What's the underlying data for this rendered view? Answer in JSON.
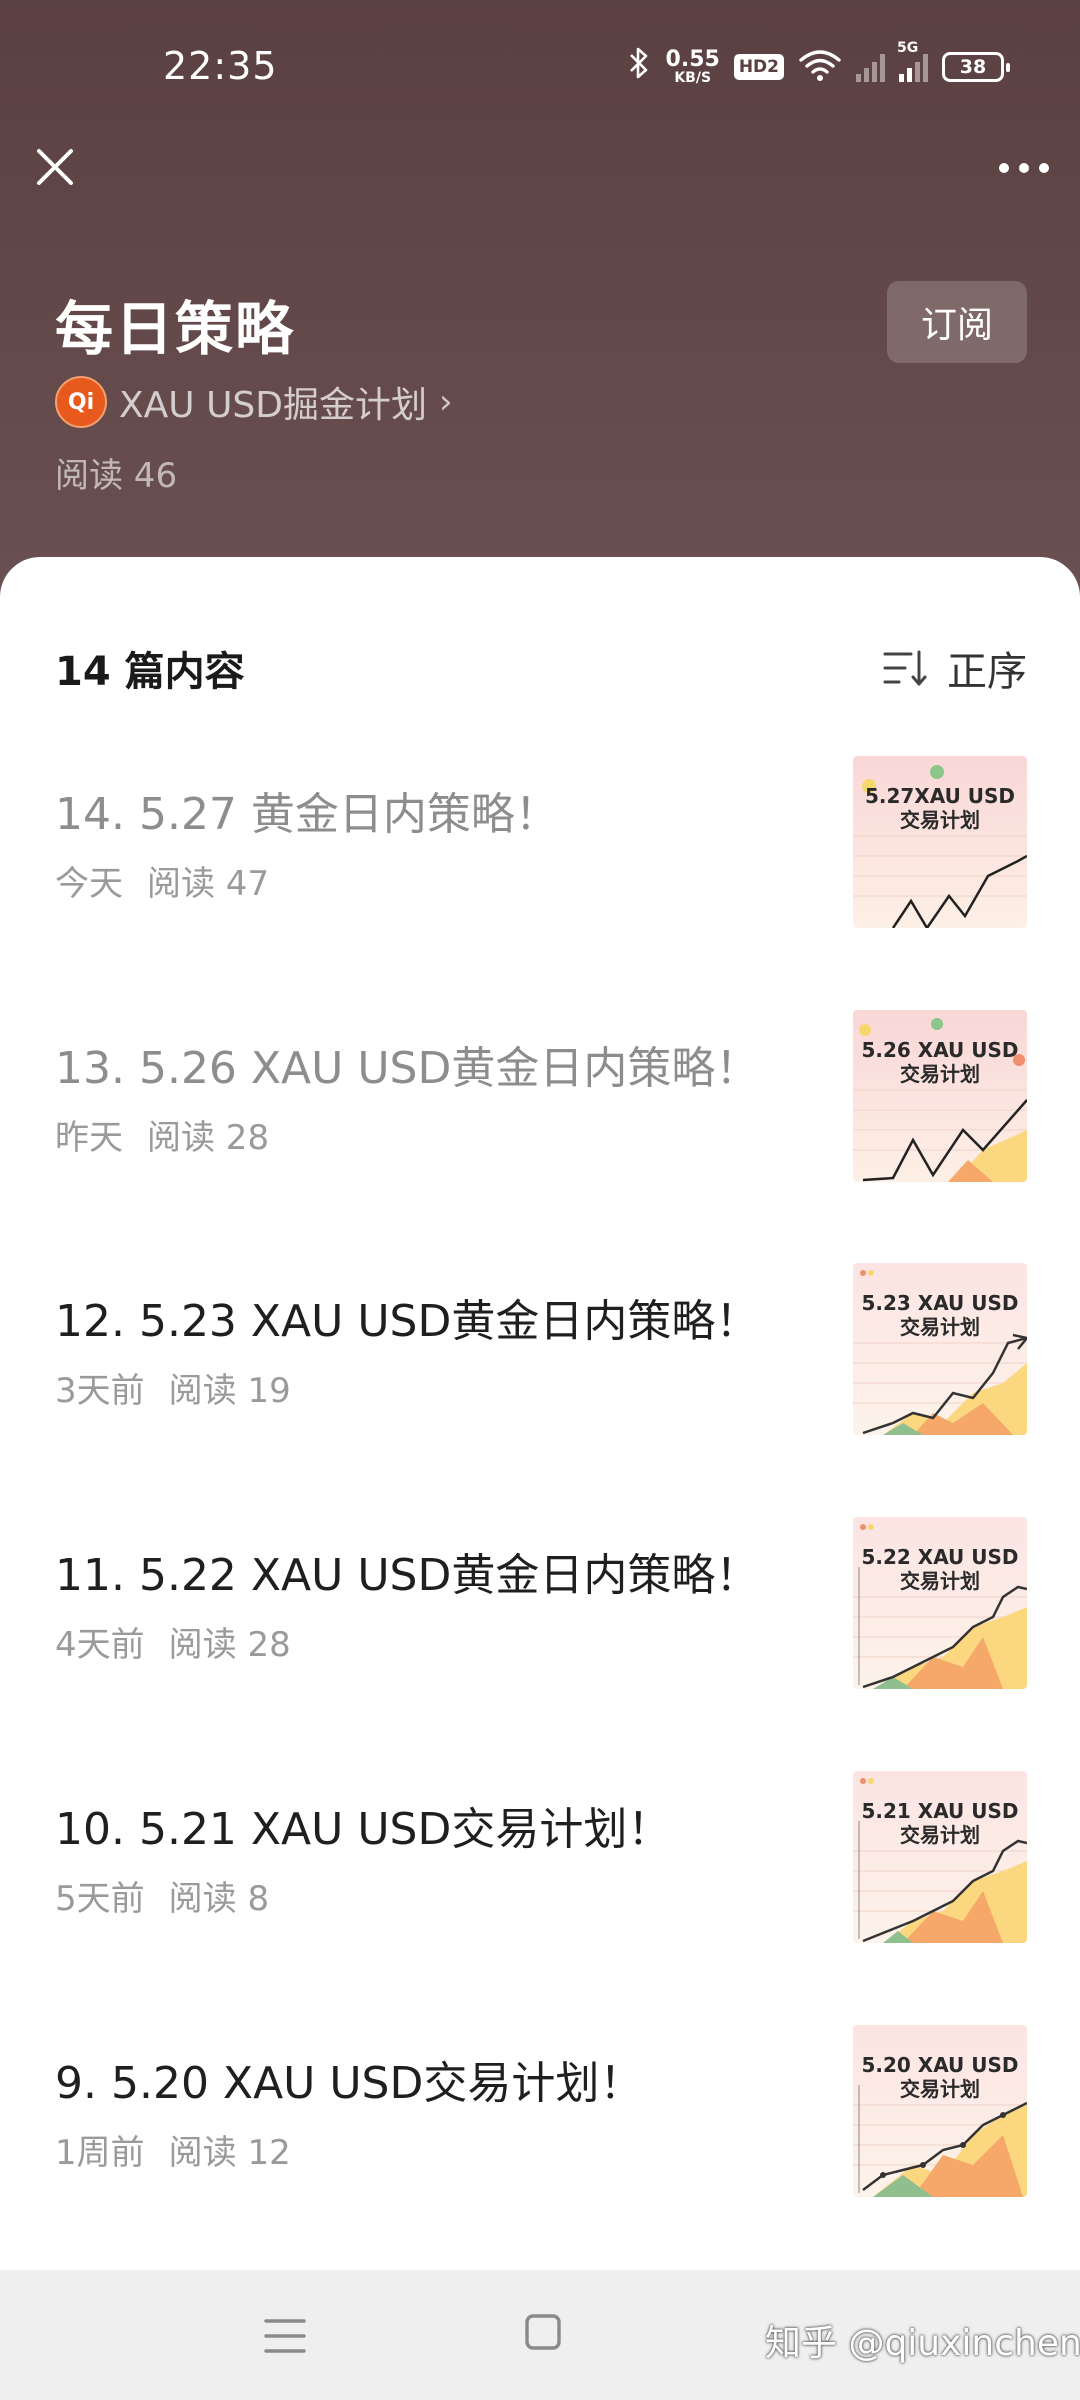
{
  "status_bar": {
    "time": "22:35",
    "net_speed_value": "0.55",
    "net_speed_unit": "KB/S",
    "hd_label": "HD2",
    "signal_tag": "5G",
    "battery_level": "38",
    "icons": [
      "bluetooth-icon",
      "wifi-icon",
      "signal-icon",
      "battery-icon"
    ]
  },
  "header": {
    "title": "每日策略",
    "subscribe_label": "订阅",
    "author": {
      "avatar_text": "Qi",
      "name": "XAU USD掘金计划"
    },
    "read_count": "阅读 46"
  },
  "list": {
    "count_label": "14 篇内容",
    "sort_label": "正序",
    "articles": [
      {
        "title": "14. 5.27 黄金日内策略！",
        "time": "今天",
        "reads": "阅读 47",
        "read": true,
        "thumb_title_1": "5.27XAU USD",
        "thumb_title_2": "交易计划"
      },
      {
        "title": "13. 5.26 XAU USD黄金日内策略！",
        "time": "昨天",
        "reads": "阅读 28",
        "read": true,
        "thumb_title_1": "5.26 XAU USD",
        "thumb_title_2": "交易计划"
      },
      {
        "title": "12. 5.23 XAU USD黄金日内策略！",
        "time": "3天前",
        "reads": "阅读 19",
        "read": false,
        "thumb_title_1": "5.23 XAU USD",
        "thumb_title_2": "交易计划"
      },
      {
        "title": "11. 5.22 XAU USD黄金日内策略！",
        "time": "4天前",
        "reads": "阅读 28",
        "read": false,
        "thumb_title_1": "5.22 XAU USD",
        "thumb_title_2": "交易计划"
      },
      {
        "title": "10. 5.21 XAU USD交易计划！",
        "time": "5天前",
        "reads": "阅读 8",
        "read": false,
        "thumb_title_1": "5.21 XAU USD",
        "thumb_title_2": "交易计划"
      },
      {
        "title": "9. 5.20 XAU USD交易计划！",
        "time": "1周前",
        "reads": "阅读 12",
        "read": false,
        "thumb_title_1": "5.20 XAU USD",
        "thumb_title_2": "交易计划"
      }
    ]
  },
  "nav_bar": {
    "watermark": "知乎 @qiuxincheng"
  },
  "colors": {
    "header_bg": "#5b4041",
    "avatar_bg": "#e8591e",
    "thumb_pink": "#f8dcd8",
    "thumb_orange": "#f6a76a",
    "thumb_yellow": "#fbd77f",
    "thumb_green": "#8fbf8f"
  }
}
